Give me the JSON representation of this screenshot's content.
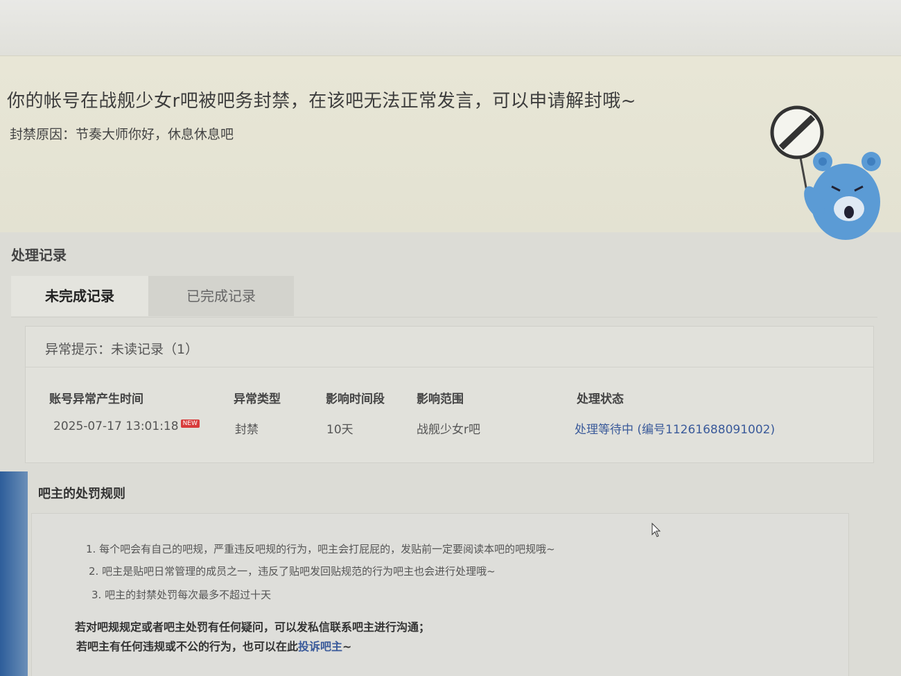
{
  "banner": {
    "title": "你的帐号在战舰少女r吧被吧务封禁，在该吧无法正常发言，可以申请解封哦~",
    "reason": "封禁原因：节奏大师你好，休息休息吧"
  },
  "records": {
    "section_title": "处理记录",
    "tabs": [
      {
        "label": "未完成记录",
        "active": true
      },
      {
        "label": "已完成记录",
        "active": false
      }
    ],
    "notice": "异常提示：未读记录（1）",
    "columns": [
      "账号异常产生时间",
      "异常类型",
      "影响时间段",
      "影响范围",
      "处理状态"
    ],
    "rows": [
      {
        "time": "2025-07-17 13:01:18",
        "badge": "NEW",
        "type": "封禁",
        "duration": "10天",
        "scope": "战舰少女r吧",
        "status": "处理等待中 (编号11261688091002)"
      }
    ]
  },
  "rules": {
    "title": "吧主的处罚规则",
    "items": [
      "1. 每个吧会有自己的吧规，严重违反吧规的行为，吧主会打屁屁的，发贴前一定要阅读本吧的吧规哦~",
      "2. 吧主是贴吧日常管理的成员之一，违反了贴吧发回贴规范的行为吧主也会进行处理哦~",
      "3. 吧主的封禁处罚每次最多不超过十天"
    ],
    "footer_line1": "若对吧规规定或者吧主处罚有任何疑问，可以发私信联系吧主进行沟通；",
    "footer_line2_prefix": "若吧主有任何违规或不公的行为，也可以在此",
    "footer_link": "投诉吧主",
    "footer_line2_suffix": "~"
  },
  "colors": {
    "link": "#3a5a9a",
    "badge": "#d83b3b",
    "mascot": "#5b9bd5"
  }
}
